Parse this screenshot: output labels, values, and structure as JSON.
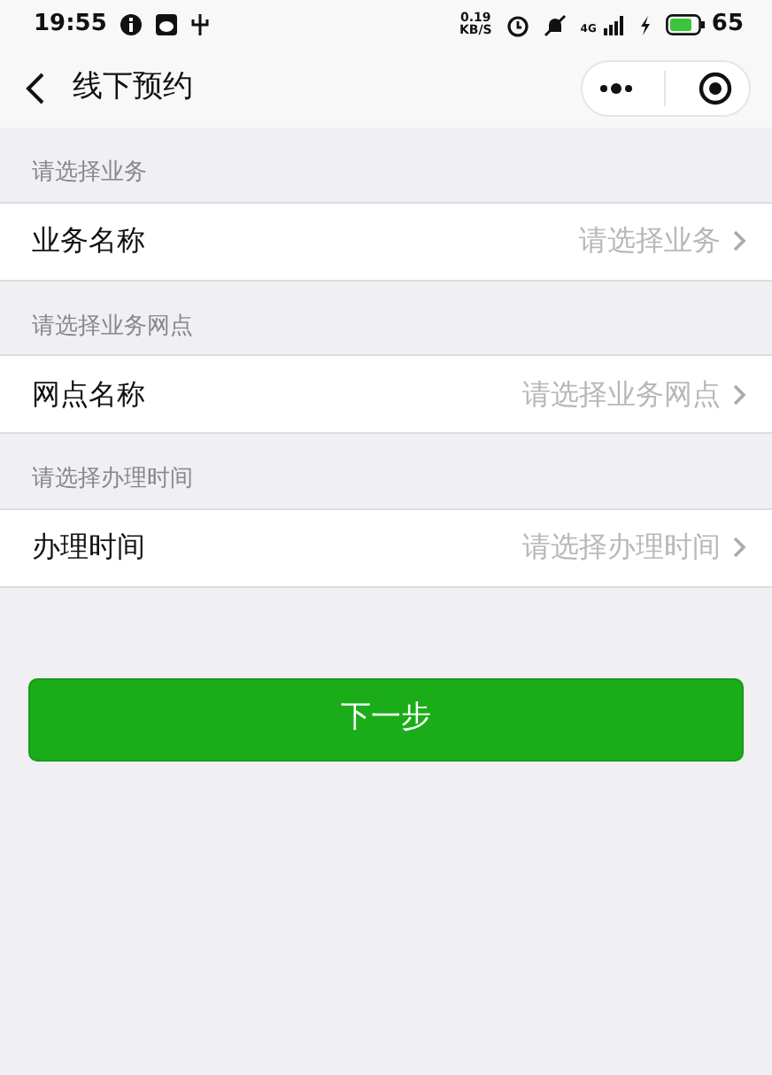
{
  "status_bar": {
    "time": "19:55",
    "speed_value": "0.19",
    "speed_unit": "KB/S",
    "network": "4G",
    "battery": "65"
  },
  "header": {
    "title": "线下预约"
  },
  "sections": [
    {
      "label": "请选择业务",
      "field": "业务名称",
      "placeholder": "请选择业务"
    },
    {
      "label": "请选择业务网点",
      "field": "网点名称",
      "placeholder": "请选择业务网点"
    },
    {
      "label": "请选择办理时间",
      "field": "办理时间",
      "placeholder": "请选择办理时间"
    }
  ],
  "next_button": "下一步"
}
